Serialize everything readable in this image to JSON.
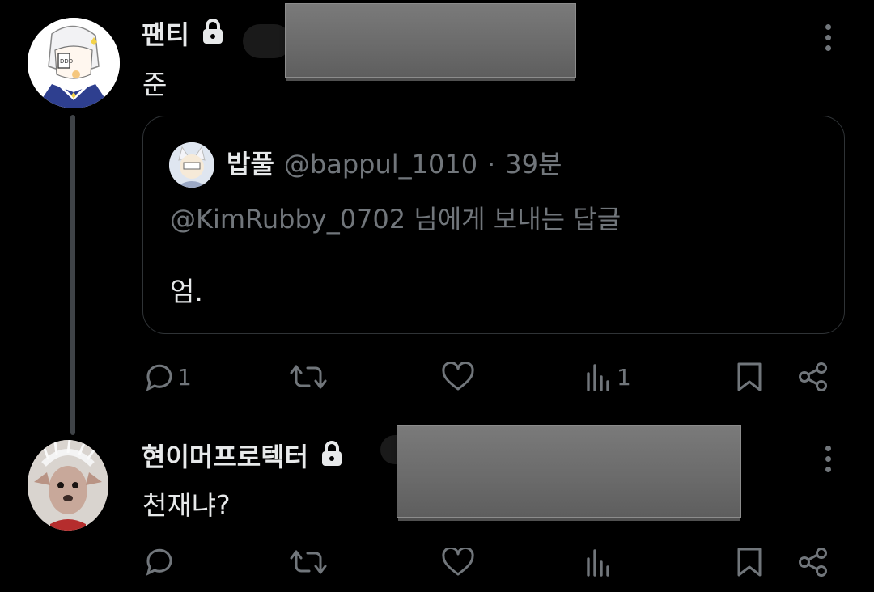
{
  "post1": {
    "name": "팬티",
    "text": "준",
    "quote": {
      "name": "밥풀",
      "handle": "@bappul_1010",
      "separator": "·",
      "time": "39분",
      "reply_to": "@KimRubby_0702 님에게 보내는 답글",
      "text": "엄."
    },
    "actions": {
      "reply_count": "1",
      "views_count": "1"
    }
  },
  "post2": {
    "name": "현이머프로텍터",
    "text": "천재냐?"
  },
  "colors": {
    "background": "#000000",
    "text": "#e7e9ea",
    "muted": "#71767b",
    "border": "#2f3336"
  },
  "icons": [
    "lock-icon",
    "more-icon",
    "reply-icon",
    "retweet-icon",
    "like-icon",
    "views-icon",
    "bookmark-icon",
    "share-icon"
  ]
}
